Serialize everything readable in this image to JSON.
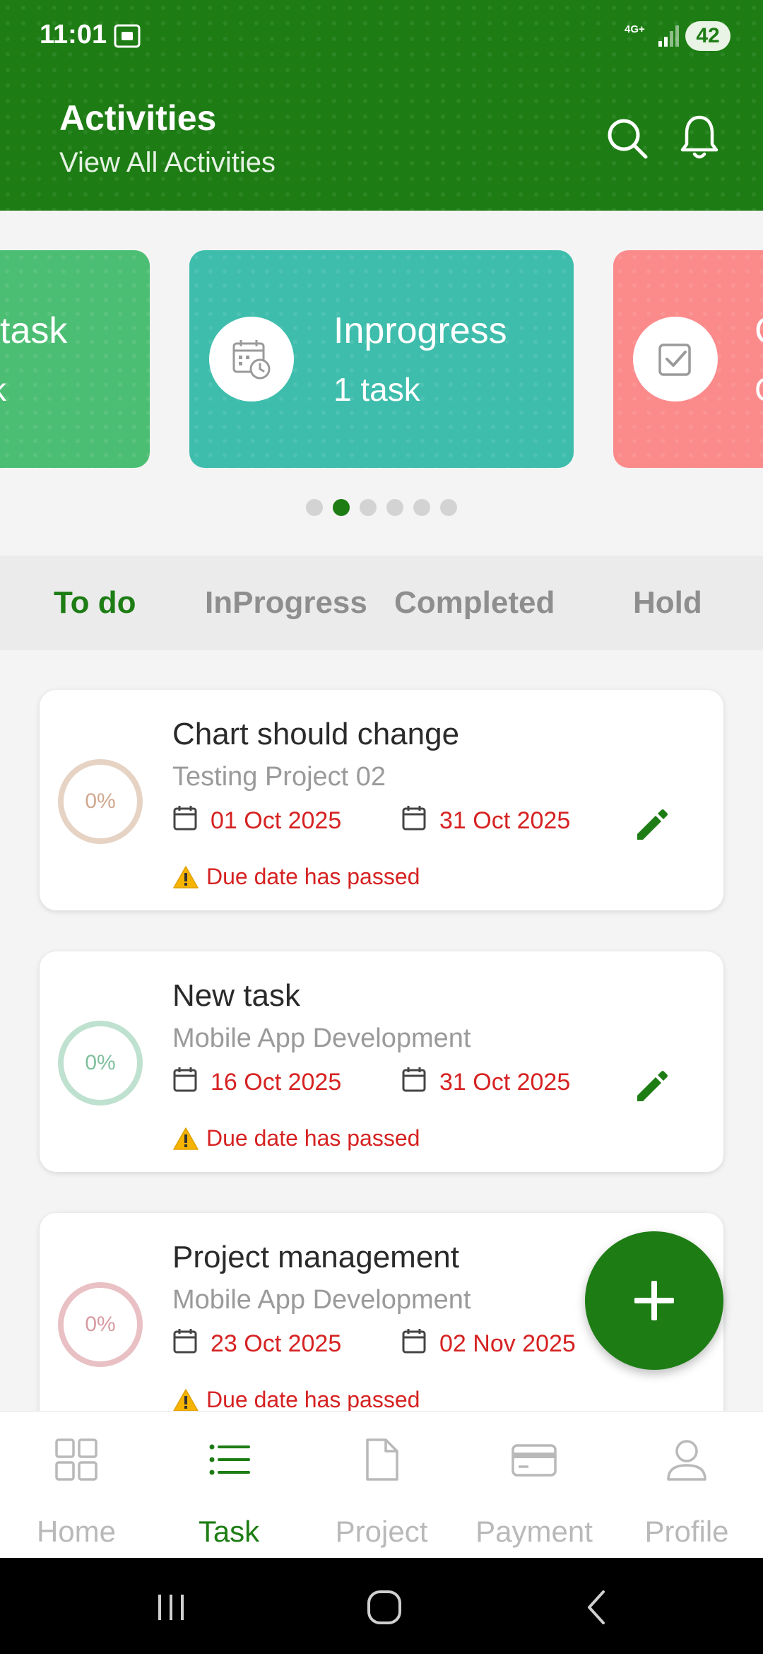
{
  "status_bar": {
    "time": "11:01",
    "network": "4G+",
    "battery": "42"
  },
  "header": {
    "title": "Activities",
    "subtitle": "View All Activities"
  },
  "carousel": {
    "cards": [
      {
        "title": "task",
        "count": "k",
        "color": "#4cbe73"
      },
      {
        "title": "Inprogress",
        "count": "1 task",
        "color": "#3fbdac",
        "icon": "calendar-clock-icon"
      },
      {
        "title": "C",
        "count": "C",
        "color": "#fb8b8b",
        "icon": "checkbox-icon"
      }
    ],
    "active_page": 2,
    "page_count": 6
  },
  "tabs": [
    {
      "label": "To do",
      "active": true
    },
    {
      "label": "InProgress",
      "active": false
    },
    {
      "label": "Completed",
      "active": false
    },
    {
      "label": "Hold",
      "active": false
    }
  ],
  "tasks": [
    {
      "progress": "0%",
      "title": "Chart should change",
      "project": "Testing Project 02",
      "start_date": "01 Oct 2025",
      "end_date": "31 Oct 2025",
      "warning": "Due date has passed"
    },
    {
      "progress": "0%",
      "title": "New task",
      "project": "Mobile App Development",
      "start_date": "16 Oct 2025",
      "end_date": "31 Oct 2025",
      "warning": "Due date has passed"
    },
    {
      "progress": "0%",
      "title": "Project management",
      "project": "Mobile App Development",
      "start_date": "23 Oct 2025",
      "end_date": "02 Nov 2025",
      "warning": "Due date has passed"
    }
  ],
  "bottom_nav": [
    {
      "label": "Home",
      "icon": "grid-icon",
      "active": false
    },
    {
      "label": "Task",
      "icon": "list-icon",
      "active": true
    },
    {
      "label": "Project",
      "icon": "document-icon",
      "active": false
    },
    {
      "label": "Payment",
      "icon": "card-icon",
      "active": false
    },
    {
      "label": "Profile",
      "icon": "user-icon",
      "active": false
    }
  ],
  "colors": {
    "primary": "#1d7d14",
    "danger": "#d62222",
    "todo_card": "#4cbe73",
    "inprogress_card": "#3fbdac",
    "completed_card": "#fb8b8b"
  }
}
